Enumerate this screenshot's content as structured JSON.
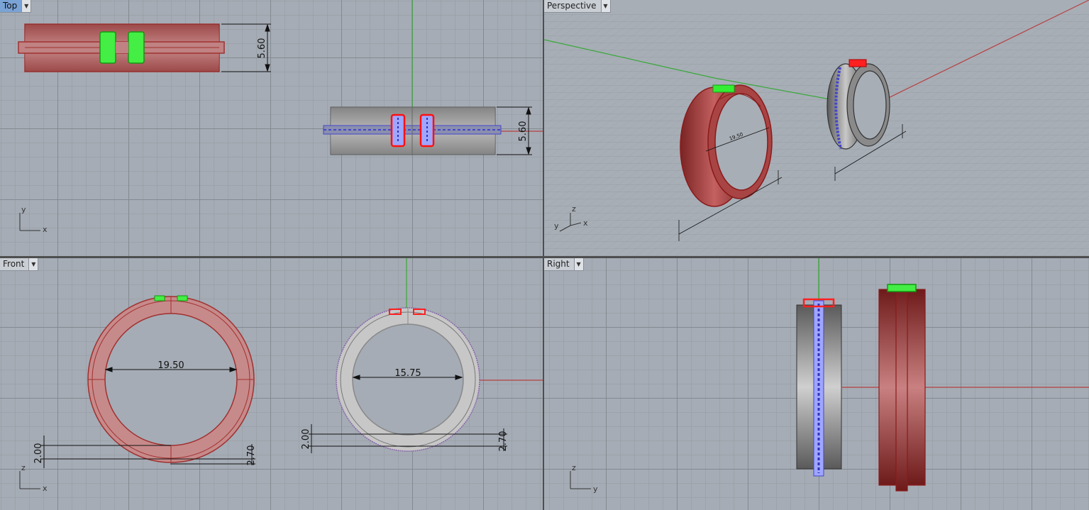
{
  "viewports": {
    "top": {
      "title": "Top",
      "dimension": "5.60",
      "dimension2": "5.60",
      "axis_a": "y",
      "axis_b": "x"
    },
    "perspective": {
      "title": "Perspective",
      "label_a": "19.50",
      "axis_z": "z",
      "axis_y": "y",
      "axis_x": "x"
    },
    "front": {
      "title": "Front",
      "diameter_left": "19.50",
      "diameter_right": "15.75",
      "thick_left": "2.00",
      "width_left": "2.70",
      "thick_right": "2.00",
      "width_right": "2.70",
      "axis_a": "z",
      "axis_b": "x"
    },
    "right": {
      "title": "Right",
      "axis_a": "z",
      "axis_b": "y"
    }
  },
  "colors": {
    "red_ring": "#b84a4a",
    "grey_ring": "#8a8a8a",
    "green_part": "#33ee33",
    "red_part": "#ff2020",
    "blue_stones": "#7a8cff",
    "x_axis": "#b84040",
    "y_axis": "#3aa83a",
    "active_title": "#7aa3d6"
  },
  "icons": {
    "dropdown": "chevron-down-icon"
  }
}
